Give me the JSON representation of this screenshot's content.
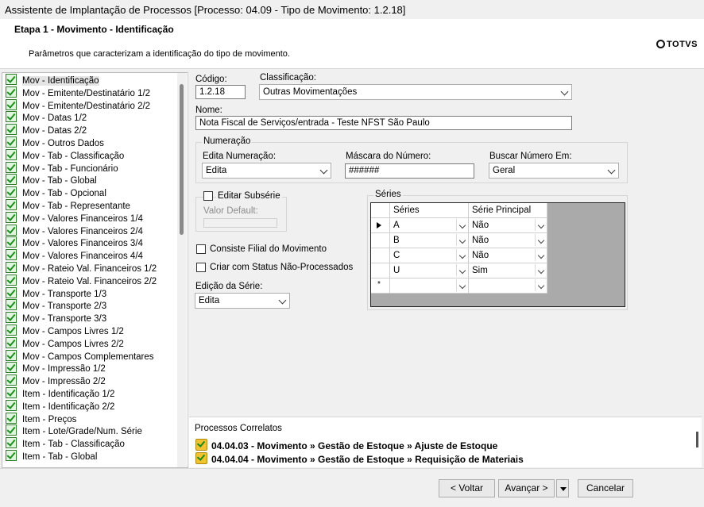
{
  "window": {
    "title": "Assistente de Implantação de Processos [Processo: 04.09 - Tipo de Movimento: 1.2.18]"
  },
  "header": {
    "step_title": "Etapa 1 - Movimento - Identificação",
    "subtitle": "Parâmetros que caracterizam a identificação do tipo de movimento.",
    "logo": "TOTVS"
  },
  "tree": {
    "items": [
      "Mov - Identificação",
      "Mov - Emitente/Destinatário 1/2",
      "Mov - Emitente/Destinatário 2/2",
      "Mov - Datas 1/2",
      "Mov - Datas 2/2",
      "Mov - Outros Dados",
      "Mov - Tab - Classificação",
      "Mov - Tab - Funcionário",
      "Mov - Tab - Global",
      "Mov - Tab - Opcional",
      "Mov - Tab - Representante",
      "Mov - Valores Financeiros 1/4",
      "Mov - Valores Financeiros 2/4",
      "Mov - Valores Financeiros 3/4",
      "Mov - Valores Financeiros 4/4",
      "Mov - Rateio Val. Financeiros 1/2",
      "Mov - Rateio Val. Financeiros 2/2",
      "Mov - Transporte 1/3",
      "Mov - Transporte 2/3",
      "Mov - Transporte 3/3",
      "Mov - Campos Livres 1/2",
      "Mov - Campos Livres 2/2",
      "Mov - Campos Complementares",
      "Mov - Impressão 1/2",
      "Mov - Impressão 2/2",
      "Item - Identificação 1/2",
      "Item - Identificação 2/2",
      "Item - Preços",
      "Item - Lote/Grade/Num. Série",
      "Item - Tab - Classificação",
      "Item - Tab - Global"
    ]
  },
  "form": {
    "codigo_label": "Código:",
    "codigo_value": "1.2.18",
    "classificacao_label": "Classificação:",
    "classificacao_value": "Outras Movimentações",
    "nome_label": "Nome:",
    "nome_value": "Nota Fiscal de Serviços/entrada - Teste NFST São Paulo",
    "numeracao_group": "Numeração",
    "edita_label": "Edita Numeração:",
    "edita_value": "Edita",
    "mascara_label": "Máscara do Número:",
    "mascara_value": "######",
    "buscar_label": "Buscar Número Em:",
    "buscar_value": "Geral",
    "editar_subserie": "Editar Subsérie",
    "valor_default": "Valor Default:",
    "consiste_filial": "Consiste Filial do Movimento",
    "criar_status": "Criar com Status Não-Processados",
    "edicao_serie_label": "Edição da Série:",
    "edicao_serie_value": "Edita"
  },
  "series": {
    "group": "Séries",
    "columns": [
      "Séries",
      "Série Principal"
    ],
    "rows": [
      {
        "serie": "A",
        "principal": "Não"
      },
      {
        "serie": "B",
        "principal": "Não"
      },
      {
        "serie": "C",
        "principal": "Não"
      },
      {
        "serie": "U",
        "principal": "Sim"
      }
    ],
    "new_row_marker": "*"
  },
  "processos": {
    "title": "Processos Correlatos",
    "items": [
      "04.04.03 - Movimento » Gestão de Estoque » Ajuste de Estoque",
      "04.04.04 - Movimento » Gestão de Estoque » Requisição de Materiais"
    ]
  },
  "footer": {
    "voltar": "< Voltar",
    "avancar": "Avançar >",
    "cancelar": "Cancelar"
  }
}
